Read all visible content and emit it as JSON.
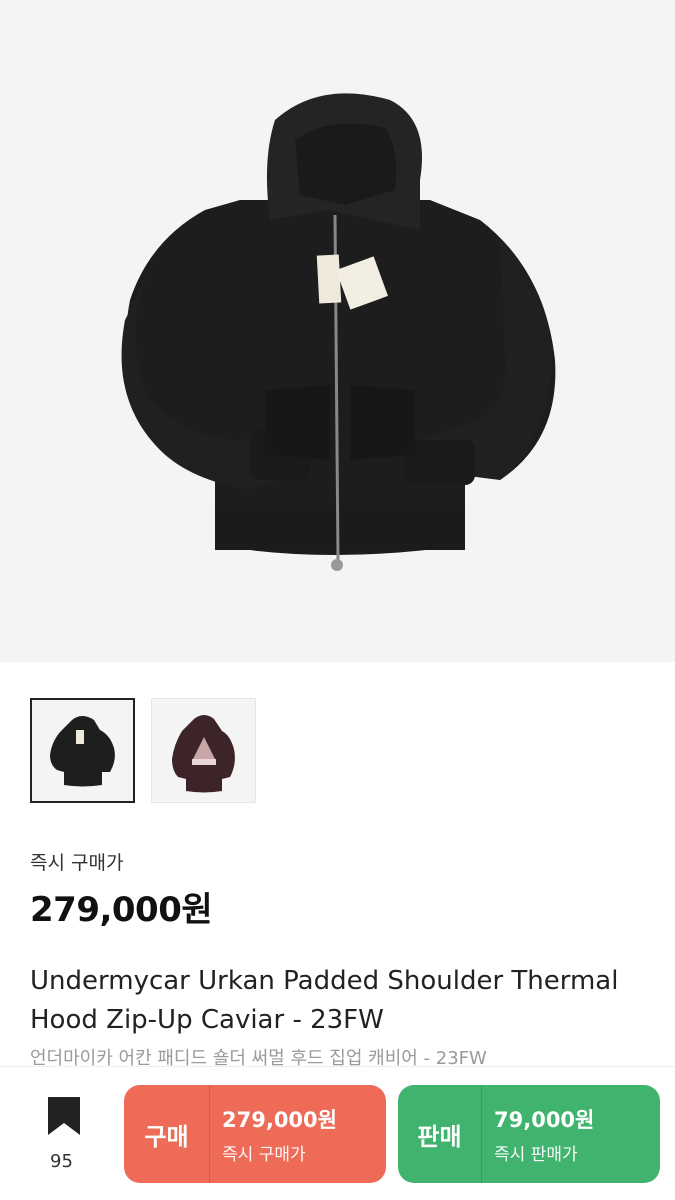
{
  "product": {
    "images": [
      {
        "alt": "black zip-up hoodie front",
        "selected": true
      },
      {
        "alt": "burgundy hoodie back print",
        "selected": false
      }
    ],
    "instant_buy_label": "즉시 구매가",
    "instant_buy_price": "279,000원",
    "title_en": "Undermycar Urkan Padded Shoulder Thermal Hood Zip-Up Caviar - 23FW",
    "title_ko": "언더마이카 어칸 패디드 숄더 써멀 후드 집업 캐비어 - 23FW"
  },
  "bottom_bar": {
    "bookmark_icon": "bookmark-icon",
    "bookmark_count": "95",
    "buy": {
      "label": "구매",
      "price": "279,000원",
      "sub": "즉시 구매가",
      "color": "#ee6b57"
    },
    "sell": {
      "label": "판매",
      "price": "79,000원",
      "sub": "즉시 판매가",
      "color": "#40b46e"
    }
  }
}
